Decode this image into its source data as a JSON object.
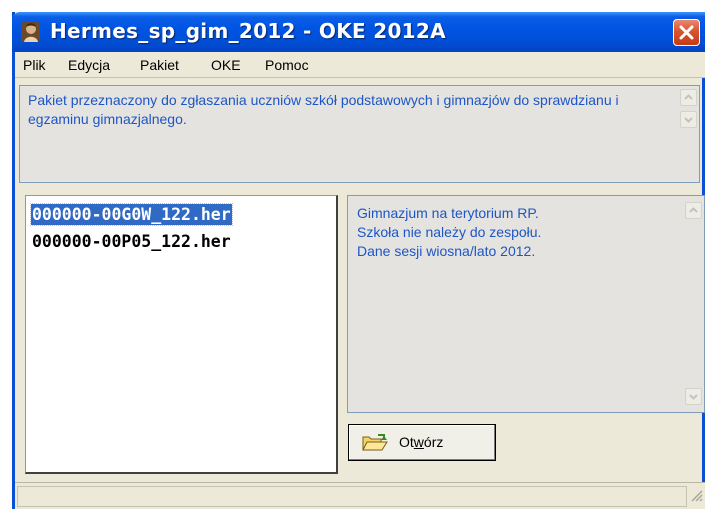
{
  "window": {
    "title": "Hermes_sp_gim_2012 - OKE 2012A"
  },
  "menu": {
    "items": [
      "Plik",
      "Edycja",
      "Pakiet",
      "OKE",
      "Pomoc"
    ]
  },
  "description": {
    "text": "Pakiet przeznaczony do zgłaszania uczniów szkół podstawowych i gimnazjów do sprawdzianu i egzaminu gimnazjalnego."
  },
  "files": {
    "items": [
      "000000-00G0W_122.her",
      "000000-00P05_122.her"
    ],
    "selected_index": 0
  },
  "info": {
    "line1": "Gimnazjum na terytorium RP.",
    "line2": "Szkoła nie należy do zespołu.",
    "line3": "Dane sesji wiosna/lato 2012."
  },
  "open_button": {
    "label_pre": "Ot",
    "label_underlined": "w",
    "label_post": "órz"
  },
  "icons": {
    "app": "app-icon",
    "close": "close-icon",
    "open": "folder-open-icon",
    "scroll_up": "chevron-up-icon",
    "scroll_down": "chevron-down-icon",
    "resize": "resize-grip-icon"
  },
  "colors": {
    "title_bar": "#0054e3",
    "close_button": "#d9532e",
    "info_text": "#1d56c6",
    "selection": "#316ac5"
  }
}
